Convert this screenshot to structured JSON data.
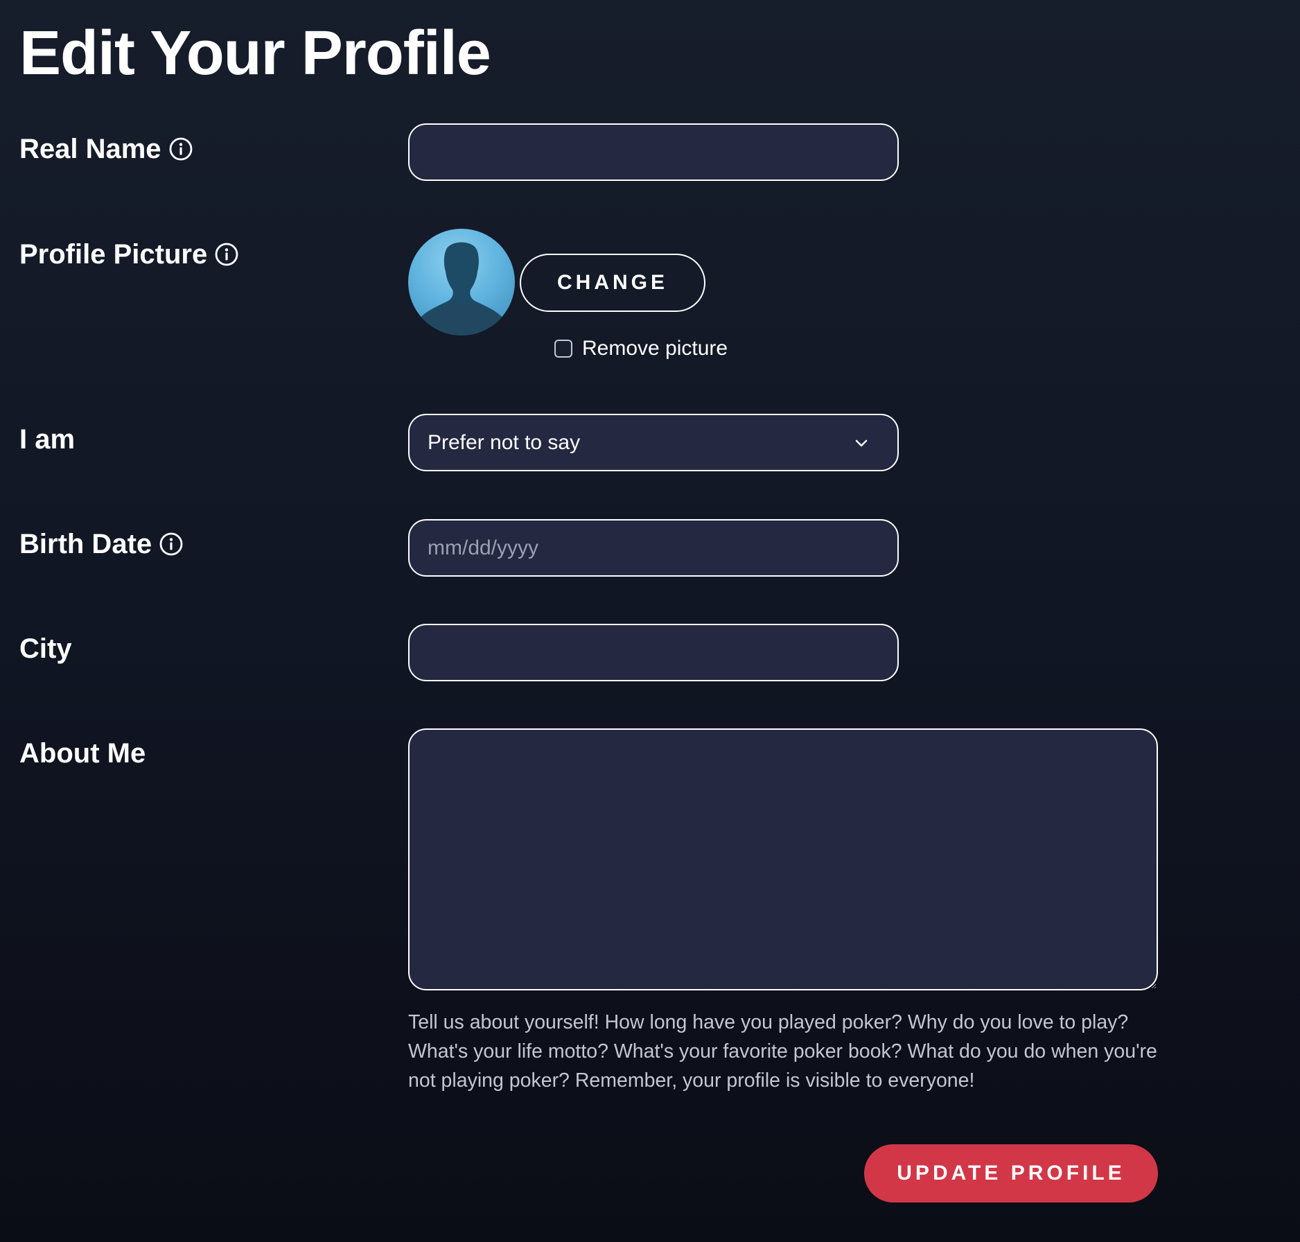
{
  "page": {
    "title": "Edit Your Profile"
  },
  "fields": {
    "real_name": {
      "label": "Real Name",
      "value": "",
      "icon": "info-icon"
    },
    "profile_picture": {
      "label": "Profile Picture",
      "icon": "info-icon",
      "change_label": "CHANGE",
      "remove_label": "Remove picture",
      "remove_checked": false
    },
    "gender": {
      "label": "I am",
      "selected": "Prefer not to say",
      "icon": "chevron-down-icon"
    },
    "birth_date": {
      "label": "Birth Date",
      "value": "",
      "placeholder": "mm/dd/yyyy",
      "icon": "info-icon"
    },
    "city": {
      "label": "City",
      "value": ""
    },
    "about_me": {
      "label": "About Me",
      "value": "",
      "help": "Tell us about yourself! How long have you played poker? Why do you love to play? What's your life motto? What's your favorite poker book? What do you do when you're not playing poker? Remember, your profile is visible to everyone!"
    }
  },
  "actions": {
    "update_label": "UPDATE PROFILE"
  },
  "colors": {
    "background": "#131a27",
    "input_fill": "#242840",
    "input_border": "#ffffff",
    "accent": "#d23748",
    "help_text": "#c4c6d2"
  }
}
